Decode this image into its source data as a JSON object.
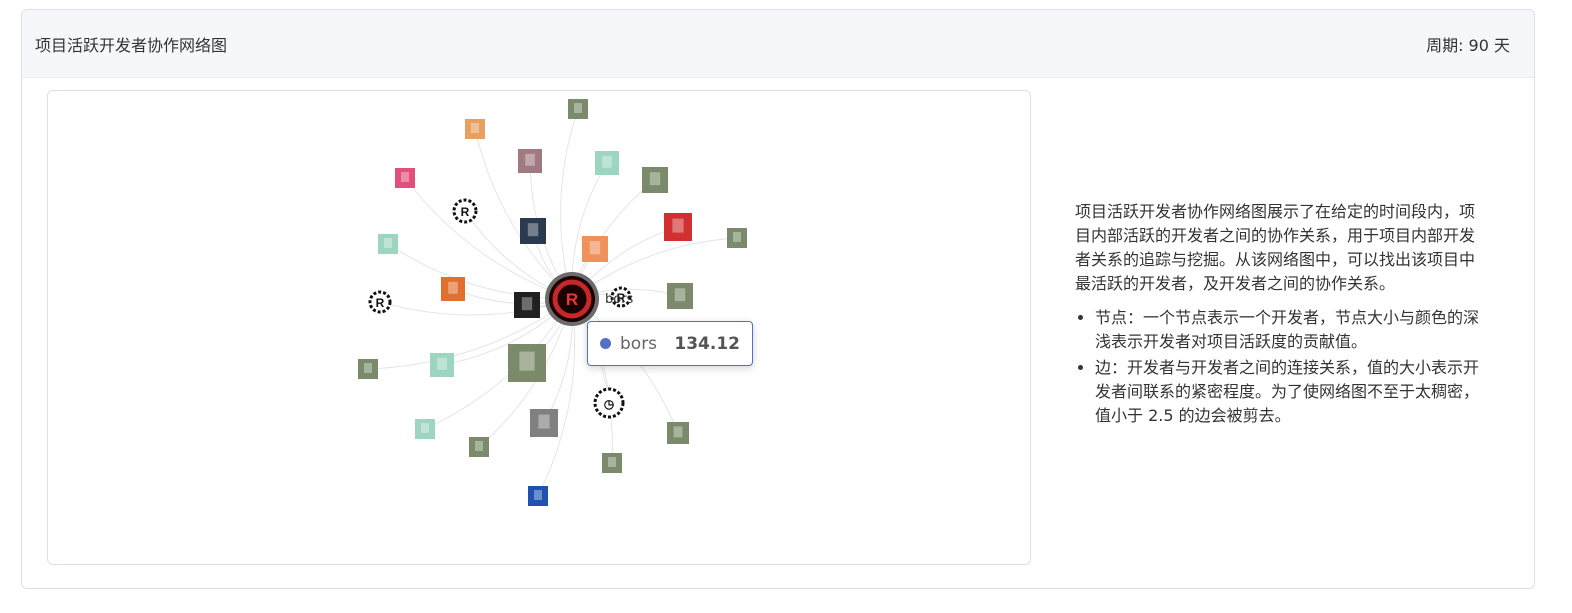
{
  "header": {
    "title": "项目活跃开发者协作网络图",
    "period": "周期: 90 天"
  },
  "colors": {
    "accent": "#5470c6",
    "edge": "#cccccc",
    "center_node": "#8b0000"
  },
  "graph": {
    "center_node": {
      "name": "bors",
      "value": 134.12,
      "icon": "rust-logo-avatar"
    },
    "nodes": [
      {
        "icon": "photo-avatar"
      },
      {
        "icon": "ghost-avatar"
      },
      {
        "icon": "mixed-avatar"
      },
      {
        "icon": "pixel-avatar"
      },
      {
        "icon": "photo-avatar"
      },
      {
        "icon": "pink-avatar"
      },
      {
        "icon": "rust-gear-avatar"
      },
      {
        "icon": "eye-avatar"
      },
      {
        "icon": "phi-avatar"
      },
      {
        "icon": "kana-avatar"
      },
      {
        "icon": "photo-avatar"
      },
      {
        "icon": "pixel-avatar"
      },
      {
        "icon": "rust-gear-avatar"
      },
      {
        "icon": "orange-avatar"
      },
      {
        "icon": "hook-avatar"
      },
      {
        "icon": "rust-gear-avatar"
      },
      {
        "icon": "photo-avatar"
      },
      {
        "icon": "photo-avatar"
      },
      {
        "icon": "pixel-avatar"
      },
      {
        "icon": "photo-avatar"
      },
      {
        "icon": "clock-avatar"
      },
      {
        "icon": "pixel-avatar"
      },
      {
        "icon": "pattern-avatar"
      },
      {
        "icon": "photo-avatar"
      },
      {
        "icon": "photo-avatar"
      },
      {
        "icon": "photo-avatar"
      },
      {
        "icon": "blue-avatar"
      }
    ]
  },
  "tooltip": {
    "name": "bors",
    "value": "134.12"
  },
  "description": {
    "intro": "项目活跃开发者协作网络图展示了在给定的时间段内，项目内部活跃的开发者之间的协作关系，用于项目内部开发者关系的追踪与挖掘。从该网络图中，可以找出该项目中最活跃的开发者，及开发者之间的协作关系。",
    "bullets": [
      "节点：一个节点表示一个开发者，节点大小与颜色的深浅表示开发者对项目活跃度的贡献值。",
      "边：开发者与开发者之间的连接关系，值的大小表示开发者间联系的紧密程度。为了使网络图不至于太稠密，值小于 2.5 的边会被剪去。"
    ]
  }
}
